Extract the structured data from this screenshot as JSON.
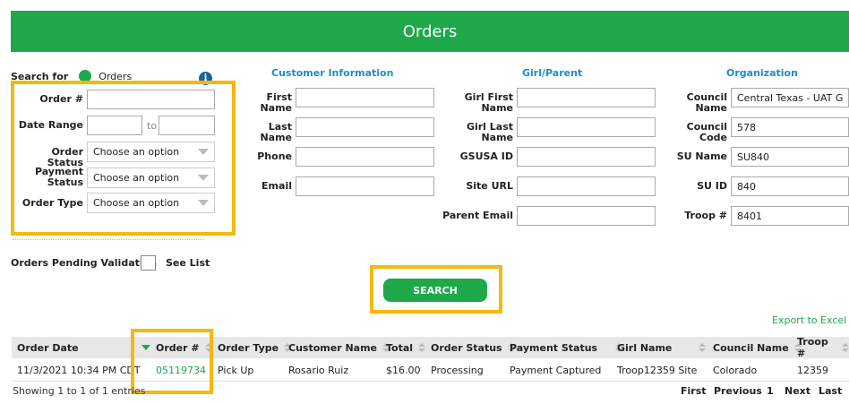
{
  "header": {
    "title": "Orders"
  },
  "search_for": {
    "label": "Search for",
    "option": "Orders",
    "info_icon": "info-icon"
  },
  "left_form": {
    "order_no_label": "Order #",
    "date_range_label": "Date Range",
    "date_to": "to",
    "order_status_label": "Order Status",
    "order_status_value": "Choose an option",
    "payment_status_label_1": "Payment",
    "payment_status_label_2": "Status",
    "payment_status_value": "Choose an option",
    "order_type_label": "Order Type",
    "order_type_value": "Choose an option"
  },
  "customer": {
    "heading": "Customer Information",
    "first_name": "First Name",
    "last_name": "Last Name",
    "phone": "Phone",
    "email": "Email"
  },
  "girl": {
    "heading": "Girl/Parent",
    "first_name": "Girl First Name",
    "last_name": "Girl Last Name",
    "gsusa_id": "GSUSA ID",
    "site_url": "Site URL",
    "parent_email": "Parent Email"
  },
  "org": {
    "heading": "Organization",
    "council_name_label": "Council Name",
    "council_name_value": "Central Texas - UAT GBP",
    "council_code_label": "Council Code",
    "council_code_value": "578",
    "su_name_label": "SU Name",
    "su_name_value": "SU840",
    "su_id_label": "SU ID",
    "su_id_value": "840",
    "troop_label": "Troop #",
    "troop_value": "8401"
  },
  "pending": {
    "label": "Orders Pending Validation",
    "see_list": "See List"
  },
  "search_button": "SEARCH",
  "export": "Export to Excel",
  "table": {
    "columns": [
      "Order Date",
      "Order #",
      "Order Type",
      "Customer Name",
      "Total",
      "Order Status",
      "Payment Status",
      "Girl Name",
      "Council Name",
      "Troop #"
    ],
    "rows": [
      [
        "11/3/2021 10:34 PM CDT",
        "05119734",
        "Pick Up",
        "Rosario Ruiz",
        "$16.00",
        "Processing",
        "Payment Captured",
        "Troop12359 Site",
        "Colorado",
        "12359"
      ]
    ]
  },
  "footer": {
    "showing": "Showing 1 to 1 of 1 entries",
    "first": "First",
    "previous": "Previous",
    "page": "1",
    "next": "Next",
    "last": "Last"
  },
  "colors": {
    "brand_green": "#1ea84a",
    "highlight": "#f5b80f",
    "heading_blue": "#1a8fc9"
  }
}
